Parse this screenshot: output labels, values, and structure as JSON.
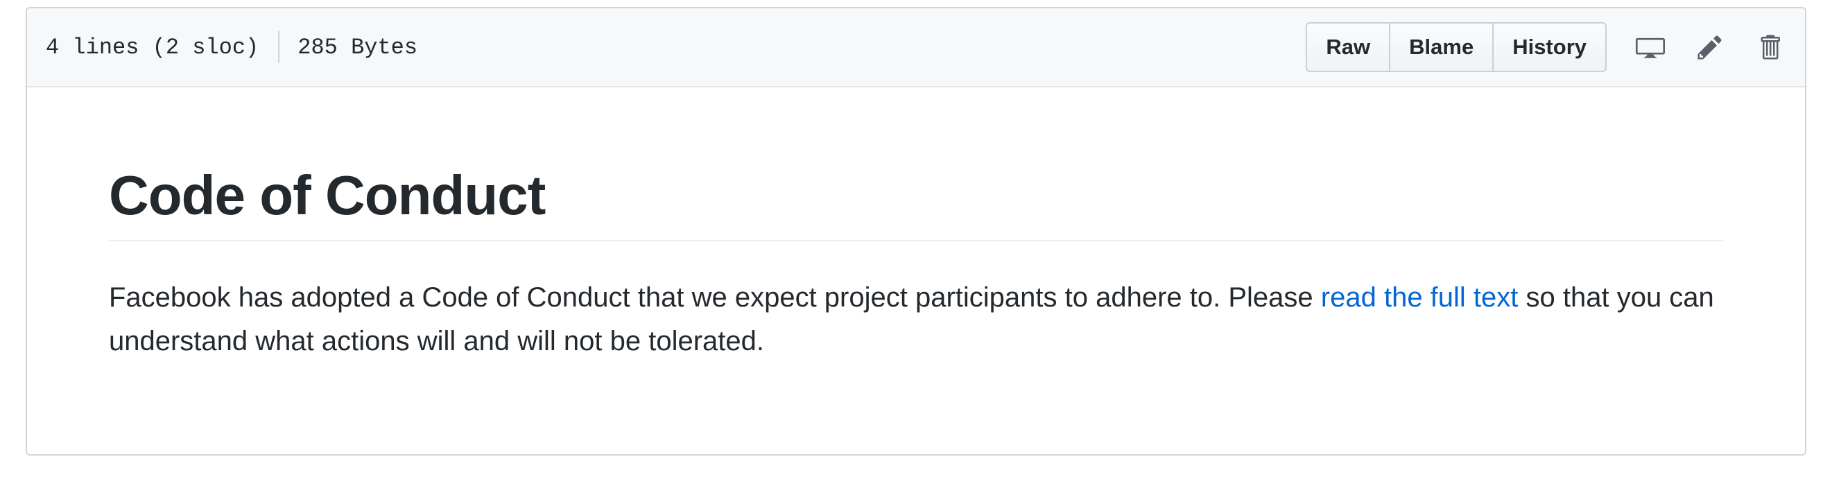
{
  "file_header": {
    "lines_info": "4 lines (2 sloc)",
    "size_info": "285 Bytes",
    "buttons": {
      "raw": "Raw",
      "blame": "Blame",
      "history": "History"
    },
    "icons": {
      "desktop": "desktop-icon",
      "edit": "pencil-icon",
      "delete": "trash-icon"
    }
  },
  "content": {
    "title": "Code of Conduct",
    "paragraph_before_link": "Facebook has adopted a Code of Conduct that we expect project participants to adhere to. Please ",
    "link_text": "read the full text",
    "paragraph_after_link": " so that you can understand what actions will and will not be tolerated."
  },
  "colors": {
    "link": "#0366d6",
    "text": "#24292e",
    "header_bg": "#f6f8fa",
    "border": "#d1d5da"
  }
}
